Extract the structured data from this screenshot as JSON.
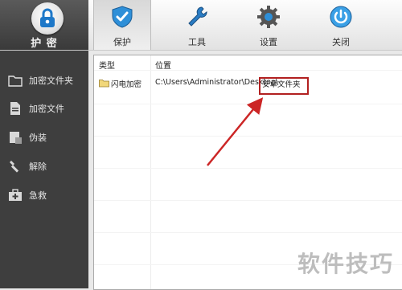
{
  "app": {
    "logo_label": "护 密"
  },
  "tabs": [
    {
      "label": "保护",
      "icon": "shield-icon"
    },
    {
      "label": "工具",
      "icon": "wrench-icon"
    },
    {
      "label": "设置",
      "icon": "gear-icon"
    },
    {
      "label": "关闭",
      "icon": "power-icon"
    }
  ],
  "sidebar": {
    "items": [
      {
        "label": "加密文件夹",
        "icon": "folder-icon"
      },
      {
        "label": "加密文件",
        "icon": "file-icon"
      },
      {
        "label": "伪装",
        "icon": "disguise-icon"
      },
      {
        "label": "解除",
        "icon": "tool-icon"
      },
      {
        "label": "急救",
        "icon": "first-aid-icon"
      }
    ]
  },
  "table": {
    "columns": [
      "类型",
      "位置"
    ],
    "rows": [
      {
        "type": "闪电加密",
        "path": "C:\\Users\\Administrator\\Desktop\\",
        "highlight": "安卓文件夹"
      }
    ]
  },
  "watermark": "软件技巧",
  "colors": {
    "accent": "#1e78c8",
    "highlight": "#b22020",
    "sidebar": "#3e3e3e"
  }
}
